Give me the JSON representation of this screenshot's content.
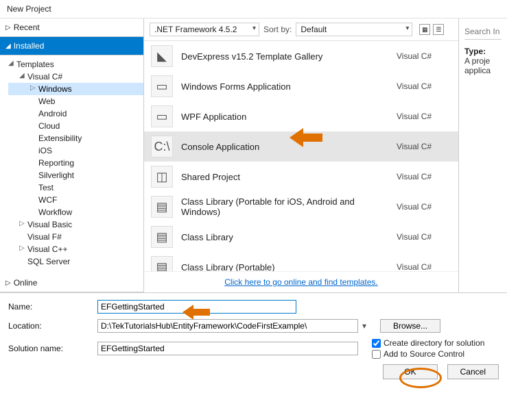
{
  "dialog_title": "New Project",
  "nav": {
    "recent": "Recent",
    "installed": "Installed",
    "online": "Online"
  },
  "tree": {
    "templates": "Templates",
    "vcsharp": "Visual C#",
    "items": [
      "Windows",
      "Web",
      "Android",
      "Cloud",
      "Extensibility",
      "iOS",
      "Reporting",
      "Silverlight",
      "Test",
      "WCF",
      "Workflow"
    ],
    "visualbasic": "Visual Basic",
    "visualfsharp": "Visual F#",
    "visualcpp": "Visual C++",
    "sql": "SQL Server"
  },
  "toolbar": {
    "framework": ".NET Framework 4.5.2",
    "sortby_label": "Sort by:",
    "sortby_value": "Default"
  },
  "templates_list": [
    {
      "name": "DevExpress v15.2 Template Gallery",
      "lang": "Visual C#",
      "icon": "◣"
    },
    {
      "name": "Windows Forms Application",
      "lang": "Visual C#",
      "icon": "▭"
    },
    {
      "name": "WPF Application",
      "lang": "Visual C#",
      "icon": "▭"
    },
    {
      "name": "Console Application",
      "lang": "Visual C#",
      "icon": "C:\\"
    },
    {
      "name": "Shared Project",
      "lang": "Visual C#",
      "icon": "◫"
    },
    {
      "name": "Class Library (Portable for iOS, Android and Windows)",
      "lang": "Visual C#",
      "icon": "▤"
    },
    {
      "name": "Class Library",
      "lang": "Visual C#",
      "icon": "▤"
    },
    {
      "name": "Class Library (Portable)",
      "lang": "Visual C#",
      "icon": "▤"
    }
  ],
  "online_link_text": "Click here to go online and find templates.",
  "search_placeholder": "Search In",
  "details": {
    "type_label": "Type:",
    "desc": "A proje applica"
  },
  "form": {
    "name_label": "Name:",
    "name_value": "EFGettingStarted",
    "location_label": "Location:",
    "location_value": "D:\\TekTutorialsHub\\EntityFramework\\CodeFirstExample\\",
    "solution_label": "Solution name:",
    "solution_value": "EFGettingStarted",
    "browse": "Browse...",
    "create_dir": "Create directory for solution",
    "add_src": "Add to Source Control"
  },
  "buttons": {
    "ok": "OK",
    "cancel": "Cancel"
  }
}
